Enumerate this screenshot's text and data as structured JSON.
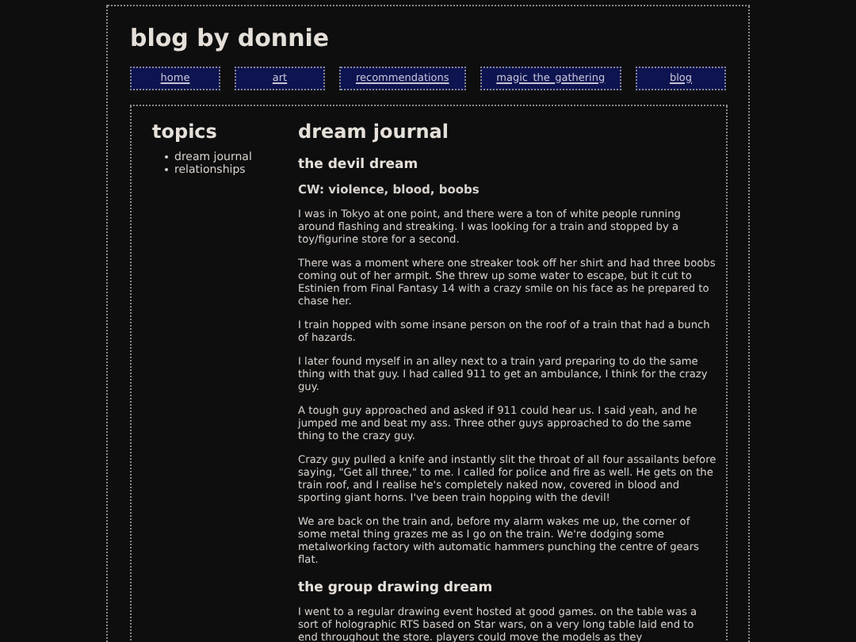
{
  "site_title": "blog by donnie",
  "nav": [
    {
      "label": "home"
    },
    {
      "label": "art"
    },
    {
      "label": "recommendations"
    },
    {
      "label": "magic_the_gathering"
    },
    {
      "label": "blog"
    }
  ],
  "sidebar": {
    "title": "topics",
    "items": [
      "dream journal",
      "relationships"
    ]
  },
  "main": {
    "title": "dream journal",
    "posts": [
      {
        "title": "the devil dream",
        "warning": "CW: violence, blood, boobs",
        "paragraphs": [
          "I was in Tokyo at one point, and there were a ton of white people running around flashing and streaking. I was looking for a train and stopped by a toy/figurine store for a second.",
          "There was a moment where one streaker took off her shirt and had three boobs coming out of her armpit. She threw up some water to escape, but it cut to Estinien from Final Fantasy 14 with a crazy smile on his face as he prepared to chase her.",
          "I train hopped with some insane person on the roof of a train that had a bunch of hazards.",
          "I later found myself in an alley next to a train yard preparing to do the same thing with that guy. I had called 911 to get an ambulance, I think for the crazy guy.",
          "A tough guy approached and asked if 911 could hear us. I said yeah, and he jumped me and beat my ass. Three other guys approached to do the same thing to the crazy guy.",
          "Crazy guy pulled a knife and instantly slit the throat of all four assailants before saying, \"Get all three,\" to me. I called for police and fire as well. He gets on the train roof, and I realise he's completely naked now, covered in blood and sporting giant horns. I've been train hopping with the devil!",
          "We are back on the train and, before my alarm wakes me up, the corner of some metal thing grazes me as I go on the train. We're dodging some metalworking factory with automatic hammers punching the centre of gears flat."
        ]
      },
      {
        "title": "the group drawing dream",
        "paragraphs": [
          "I went to a regular drawing event hosted at good games. on the table was a sort of holographic RTS based on Star wars, on a very long table laid end to end throughout the store. players could move the models as they"
        ]
      }
    ]
  }
}
